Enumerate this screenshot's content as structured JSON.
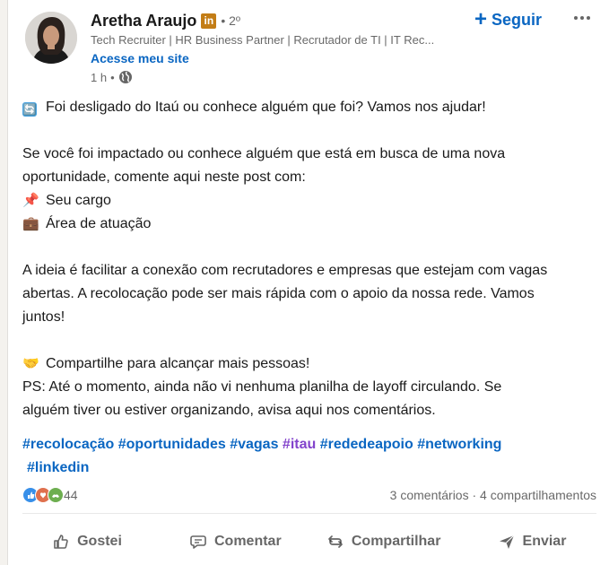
{
  "author": {
    "name": "Aretha Araujo",
    "badge": "in",
    "degree": "• 2º",
    "headline": "Tech Recruiter | HR Business Partner | Recrutador de TI | IT Rec...",
    "site_link": "Acesse meu site",
    "time": "1 h",
    "time_sep": "•"
  },
  "follow": {
    "plus": "+",
    "label": "Seguir"
  },
  "post": {
    "lines": [
      {
        "emoji": "🔄",
        "text": "Foi desligado do Itaú ou conhece alguém que foi? Vamos nos ajudar!"
      },
      {
        "text": ""
      },
      {
        "text": "Se você foi impactado ou conhece alguém que está em busca de uma nova"
      },
      {
        "text": "oportunidade, comente aqui neste post com:"
      },
      {
        "emoji": "📌",
        "text": "Seu cargo"
      },
      {
        "emoji": "💼",
        "text": "Área de atuação"
      },
      {
        "text": ""
      },
      {
        "text": "A ideia é facilitar a conexão com recrutadores e empresas que estejam com vagas"
      },
      {
        "text": "abertas. A recolocação pode ser mais rápida com o apoio da nossa rede. Vamos"
      },
      {
        "text": "juntos!"
      },
      {
        "text": ""
      },
      {
        "emoji": "🤝",
        "text": "Compartilhe para alcançar mais pessoas!"
      },
      {
        "text": "PS: Até o momento, ainda não vi nenhuma planilha de layoff circulando. Se"
      },
      {
        "text": "alguém tiver ou estiver organizando, avisa aqui nos comentários."
      }
    ]
  },
  "hashtags": [
    "#recolocação",
    "#oportunidades",
    "#vagas",
    "#itau",
    "#rededeapoio",
    "#networking",
    "#linkedin"
  ],
  "social": {
    "reaction_count": "44",
    "comments": "3 comentários",
    "sep": " · ",
    "shares": "4 compartilhamentos"
  },
  "actions": {
    "like": "Gostei",
    "comment": "Comentar",
    "repost": "Compartilhar",
    "send": "Enviar"
  },
  "colors": {
    "link": "#0a66c2",
    "visited_hashtag": "#8344cc",
    "linkedin_badge": "#c37d16"
  }
}
